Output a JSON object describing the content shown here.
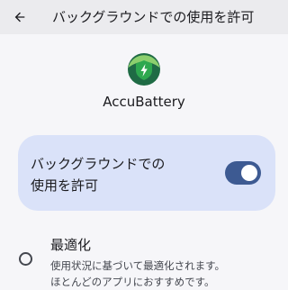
{
  "header": {
    "back_icon": "arrow-back-icon",
    "title": "バックグラウンドでの使用を許可"
  },
  "app": {
    "icon": "battery-shield-icon",
    "name": "AccuBattery"
  },
  "background_toggle": {
    "label_line1": "バックグラウンドでの",
    "label_line2": "使用を許可",
    "state": "on",
    "accent_color": "#3d5a92"
  },
  "options": [
    {
      "title": "最適化",
      "desc_line1": "使用状況に基づいて最適化されます。",
      "desc_line2": "ほとんどのアプリにおすすめです。",
      "selected": false
    }
  ]
}
